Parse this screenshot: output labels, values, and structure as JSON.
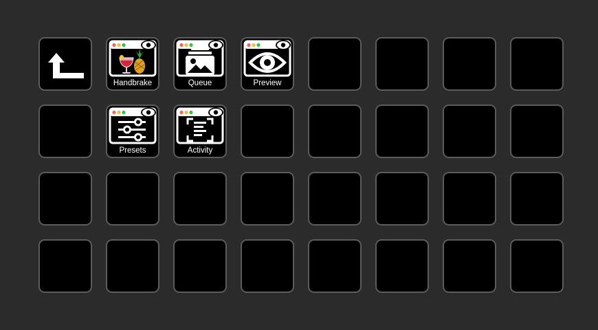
{
  "deck": {
    "rows": 4,
    "columns": 8,
    "keys": [
      {
        "icon": "back-arrow-icon",
        "label": ""
      },
      {
        "icon": "handbrake-window-icon",
        "label": "Handbrake"
      },
      {
        "icon": "queue-window-icon",
        "label": "Queue"
      },
      {
        "icon": "preview-window-icon",
        "label": "Preview"
      },
      {
        "icon": "",
        "label": ""
      },
      {
        "icon": "",
        "label": ""
      },
      {
        "icon": "",
        "label": ""
      },
      {
        "icon": "",
        "label": ""
      },
      {
        "icon": "",
        "label": ""
      },
      {
        "icon": "presets-window-icon",
        "label": "Presets"
      },
      {
        "icon": "activity-window-icon",
        "label": "Activity"
      },
      {
        "icon": "",
        "label": ""
      },
      {
        "icon": "",
        "label": ""
      },
      {
        "icon": "",
        "label": ""
      },
      {
        "icon": "",
        "label": ""
      },
      {
        "icon": "",
        "label": ""
      },
      {
        "icon": "",
        "label": ""
      },
      {
        "icon": "",
        "label": ""
      },
      {
        "icon": "",
        "label": ""
      },
      {
        "icon": "",
        "label": ""
      },
      {
        "icon": "",
        "label": ""
      },
      {
        "icon": "",
        "label": ""
      },
      {
        "icon": "",
        "label": ""
      },
      {
        "icon": "",
        "label": ""
      },
      {
        "icon": "",
        "label": ""
      },
      {
        "icon": "",
        "label": ""
      },
      {
        "icon": "",
        "label": ""
      },
      {
        "icon": "",
        "label": ""
      },
      {
        "icon": "",
        "label": ""
      },
      {
        "icon": "",
        "label": ""
      },
      {
        "icon": "",
        "label": ""
      },
      {
        "icon": "",
        "label": ""
      }
    ]
  },
  "colors": {
    "background": "#2b2b2b",
    "key_fill": "#000000",
    "key_border": "#5c5c5c",
    "traffic_red": "#ff5f57",
    "traffic_yellow": "#febc2e",
    "traffic_green": "#28c840"
  }
}
